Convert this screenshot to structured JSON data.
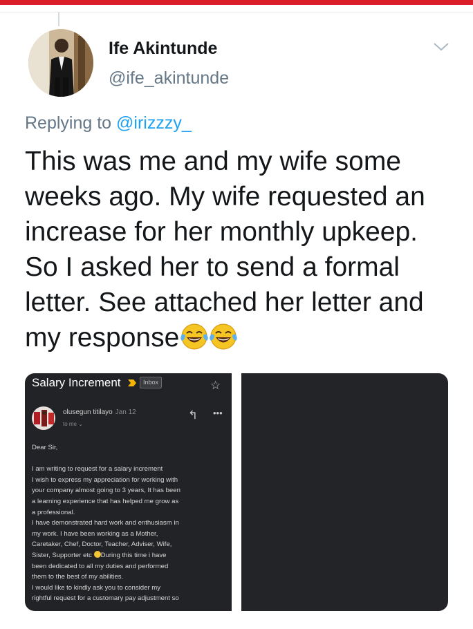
{
  "tweet": {
    "author_name": "Ife Akintunde",
    "author_handle": "@ife_akintunde",
    "replying_prefix": "Replying to",
    "replying_to": "@irizzzy_",
    "text_lines": [
      "This was me and my wife some",
      "weeks ago. My wife requested an",
      "increase for her monthly upkeep.",
      "So I asked her to send a formal",
      "letter.  See attached her letter and",
      "my response"
    ],
    "emojis": [
      "face-with-tears-of-joy-icon",
      "face-with-tears-of-joy-icon"
    ]
  },
  "media": {
    "email": {
      "subject": "Salary Increment",
      "label": "Inbox",
      "sender": "olusegun titilayo",
      "date": "Jan 12",
      "to": "to me ⌄",
      "body_lines": [
        "Dear Sir,",
        "",
        "I am writing to request for a salary increment",
        "I wish to express my appreciation for working with",
        "your company almost going to 3 years, It has been",
        "a learning experience that has helped me grow as",
        "a professional.",
        "I have demonstrated hard work and enthusiasm in",
        "my work. I have been working as a Mother,",
        "Caretaker, Chef, Doctor, Teacher, Adviser, Wife,",
        "Sister, Supporter etc",
        "During this time i have",
        "been dedicated to all my duties and performed",
        "them to the best of my abilities.",
        "I would like to kindly ask you to consider my",
        "rightful request for a customary pay adjustment so"
      ]
    }
  },
  "colors": {
    "accent_link": "#1da1f2",
    "muted": "#657786",
    "text": "#14171a",
    "top_strip": "#d9202a",
    "dark_media": "#222327"
  }
}
